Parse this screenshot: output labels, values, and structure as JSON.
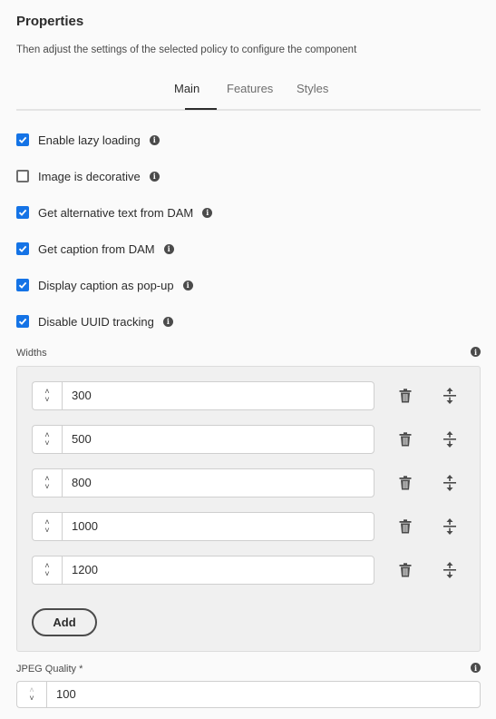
{
  "header": {
    "title": "Properties",
    "subtitle": "Then adjust the settings of the selected policy to configure the component"
  },
  "tabs": [
    {
      "label": "Main",
      "active": true
    },
    {
      "label": "Features",
      "active": false
    },
    {
      "label": "Styles",
      "active": false
    }
  ],
  "checkboxes": [
    {
      "label": "Enable lazy loading",
      "checked": true
    },
    {
      "label": "Image is decorative",
      "checked": false
    },
    {
      "label": "Get alternative text from DAM",
      "checked": true
    },
    {
      "label": "Get caption from DAM",
      "checked": true
    },
    {
      "label": "Display caption as pop-up",
      "checked": true
    },
    {
      "label": "Disable UUID tracking",
      "checked": true
    }
  ],
  "widths": {
    "label": "Widths",
    "values": [
      "300",
      "500",
      "800",
      "1000",
      "1200"
    ],
    "add_label": "Add"
  },
  "jpeg_quality": {
    "label": "JPEG Quality *",
    "value": "100"
  },
  "icons": {
    "info": "info-icon",
    "delete": "trash-icon",
    "reorder": "drag-handle-icon",
    "stepper": "chevron-up-down-icon"
  },
  "colors": {
    "accent": "#1473e6",
    "text": "#2c2c2c",
    "panel": "#f0f0f0"
  }
}
